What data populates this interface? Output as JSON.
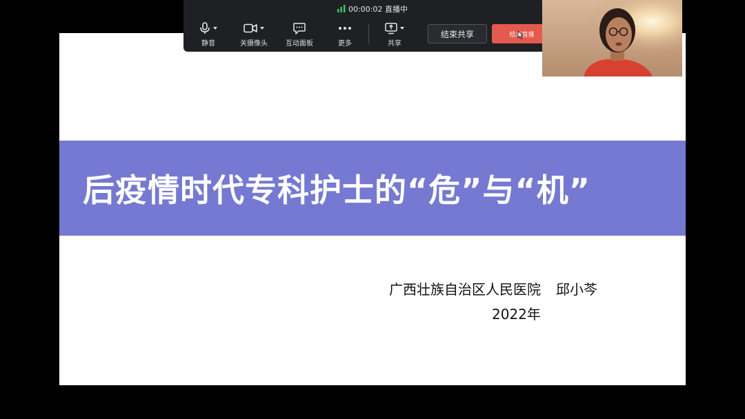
{
  "toolbar": {
    "live_timer": "00:00:02",
    "live_status": "直播中",
    "buttons": [
      {
        "icon": "microphone-icon",
        "label": "静音"
      },
      {
        "icon": "camera-icon",
        "label": "关摄像头"
      },
      {
        "icon": "interaction-panel-icon",
        "label": "互动面板"
      },
      {
        "icon": "more-icon",
        "label": "更多"
      },
      {
        "icon": "screen-share-icon",
        "label": "共享"
      }
    ],
    "end_share_label": "结束共享",
    "end_live_label": "结束直播",
    "colors": {
      "bar_background": "#1f2023",
      "end_live": "#e45a4f",
      "signal": "#3fc75b"
    }
  },
  "slide": {
    "title": "后疫情时代专科护士的“危”与“机”",
    "organization": "广西壮族自治区人民医院",
    "presenter_name": "邱小芩",
    "year": "2022年",
    "colors": {
      "title_band": "#7579d1",
      "background": "#ffffff"
    }
  },
  "camera": {
    "icon": "presenter-webcam-feed"
  }
}
